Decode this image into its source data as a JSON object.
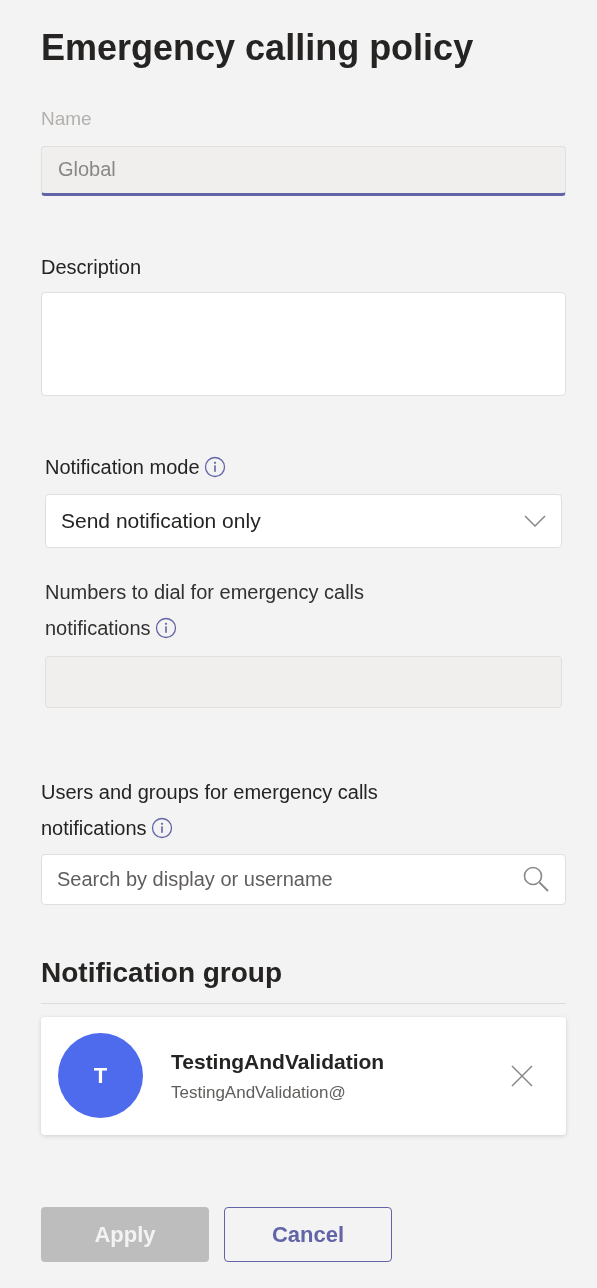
{
  "title": "Emergency calling policy",
  "name_field": {
    "label": "Name",
    "value": "Global",
    "disabled": true
  },
  "description_field": {
    "label": "Description"
  },
  "notification_mode": {
    "label": "Notification mode",
    "value": "Send notification only"
  },
  "numbers_field": {
    "label_lines": [
      "Numbers to dial for emergency calls",
      "notifications"
    ],
    "disabled": true
  },
  "users_field": {
    "label_lines": [
      "Users and groups for emergency calls",
      "notifications"
    ],
    "placeholder": "Search by display or username"
  },
  "notification_group": {
    "heading": "Notification group",
    "members": [
      {
        "initial": "T",
        "name": "TestingAndValidation",
        "email": "TestingAndValidation@",
        "color": "#4f6bed"
      }
    ]
  },
  "buttons": [
    {
      "label": "Apply",
      "kind": "primary",
      "disabled": true
    },
    {
      "label": "Cancel",
      "kind": "secondary",
      "disabled": false
    }
  ]
}
